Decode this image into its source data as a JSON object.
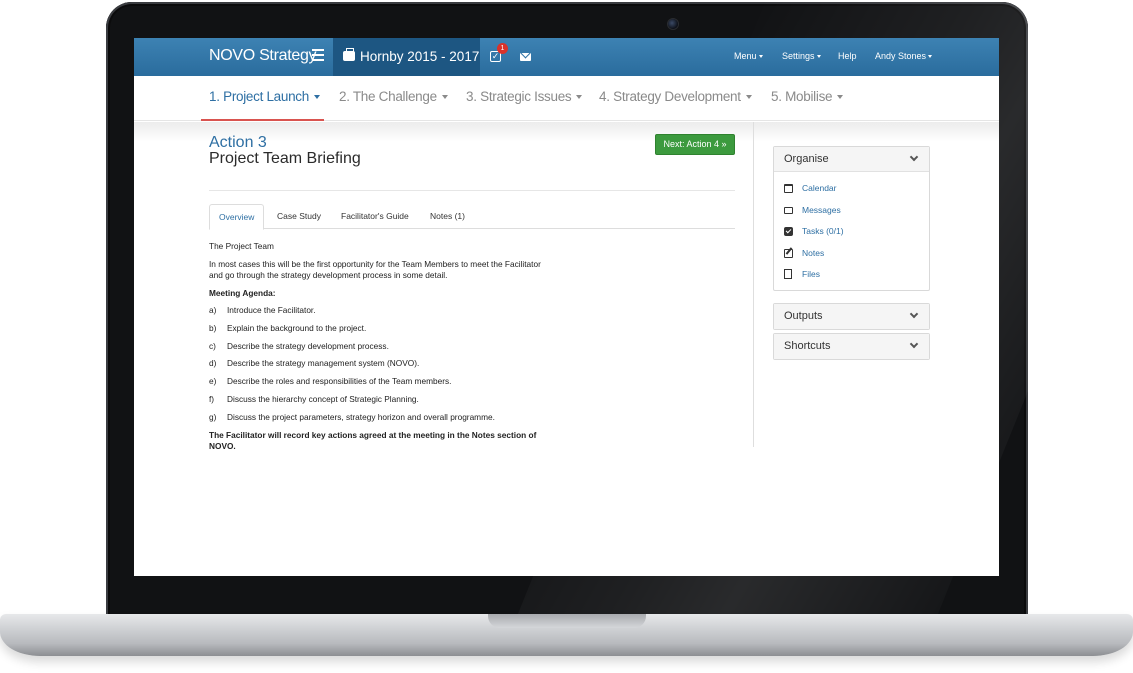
{
  "app": {
    "brand": "NOVO Strategy",
    "project": "Hornby 2015 - 2017",
    "task_badge": "1"
  },
  "topnav": {
    "menu": "Menu",
    "settings": "Settings",
    "help": "Help",
    "user": "Andy Stones"
  },
  "steps": [
    {
      "label": "1. Project Launch",
      "active": true
    },
    {
      "label": "2. The Challenge",
      "active": false
    },
    {
      "label": "3. Strategic Issues",
      "active": false
    },
    {
      "label": "4. Strategy Development",
      "active": false
    },
    {
      "label": "5. Mobilise",
      "active": false
    }
  ],
  "action": {
    "number": "Action 3",
    "title": "Project Team Briefing",
    "next_button": "Next: Action 4 »"
  },
  "tabs": [
    "Overview",
    "Case Study",
    "Facilitator's Guide",
    "Notes (1)"
  ],
  "content": {
    "heading": "The Project Team",
    "intro": "In most cases this will be the first opportunity for the Team Members to meet the Facilitator and go through the strategy development process in some detail.",
    "agenda_title": "Meeting  Agenda:",
    "agenda": [
      {
        "letter": "a)",
        "text": "Introduce the Facilitator."
      },
      {
        "letter": "b)",
        "text": "Explain the background to the project."
      },
      {
        "letter": "c)",
        "text": "Describe the strategy development process."
      },
      {
        "letter": "d)",
        "text": "Describe the strategy management system (NOVO)."
      },
      {
        "letter": "e)",
        "text": "Describe the roles and responsibilities of the Team members."
      },
      {
        "letter": "f)",
        "text": "Discuss the hierarchy concept of Strategic Planning."
      },
      {
        "letter": "g)",
        "text": "Discuss the project parameters, strategy horizon and overall programme."
      }
    ],
    "closing": "The Facilitator will record key actions agreed at the meeting in the Notes section of NOVO."
  },
  "sidebar": {
    "organise": {
      "title": "Organise",
      "links": [
        {
          "label": "Calendar",
          "icon": "calendar-icon"
        },
        {
          "label": "Messages",
          "icon": "envelope-icon"
        },
        {
          "label": "Tasks (0/1)",
          "icon": "checkbox-icon"
        },
        {
          "label": "Notes",
          "icon": "edit-icon"
        },
        {
          "label": "Files",
          "icon": "file-icon"
        }
      ]
    },
    "outputs": {
      "title": "Outputs"
    },
    "shortcuts": {
      "title": "Shortcuts"
    }
  },
  "colors": {
    "navbar": "#2f72a4",
    "accent": "#2e6fa3",
    "next_button": "#3c9a3e",
    "active_underline": "#d9534f"
  }
}
